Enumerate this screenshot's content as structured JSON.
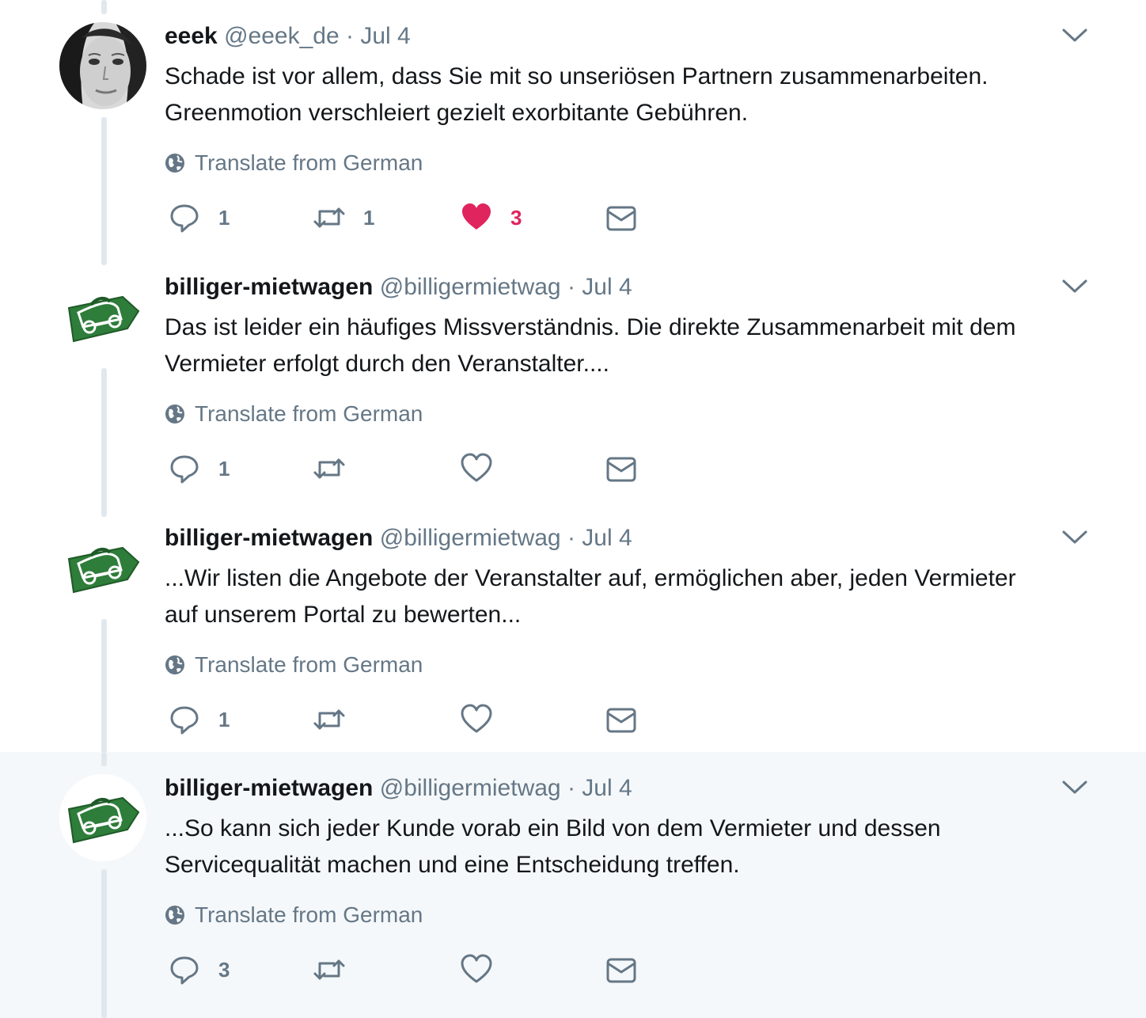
{
  "tweets": [
    {
      "name": "eeek",
      "handle": "@eeek_de",
      "separator": "·",
      "date": "Jul 4",
      "text_line1": "Schade ist vor allem, dass Sie mit so unseriösen Partnern zusammenarbeiten.",
      "text_line2": "Greenmotion verschleiert gezielt exorbitante Gebühren.",
      "translate": "Translate from German",
      "reply_count": "1",
      "retweet_count": "1",
      "like_count": "3",
      "liked": true,
      "avatar": "person-photo"
    },
    {
      "name": "billiger-mietwagen",
      "handle": "@billigermietwag",
      "separator": "·",
      "date": "Jul 4",
      "text_line1": "Das ist leider ein häufiges Missverständnis. Die direkte Zusammenarbeit mit dem",
      "text_line2": "Vermieter erfolgt durch den Veranstalter....",
      "translate": "Translate from German",
      "reply_count": "1",
      "retweet_count": "",
      "like_count": "",
      "liked": false,
      "avatar": "green-car-tag-logo"
    },
    {
      "name": "billiger-mietwagen",
      "handle": "@billigermietwag",
      "separator": "·",
      "date": "Jul 4",
      "text_line1": "...Wir listen die Angebote der Veranstalter auf, ermöglichen aber, jeden Vermieter",
      "text_line2": "auf unserem Portal zu bewerten...",
      "translate": "Translate from German",
      "reply_count": "1",
      "retweet_count": "",
      "like_count": "",
      "liked": false,
      "avatar": "green-car-tag-logo"
    },
    {
      "name": "billiger-mietwagen",
      "handle": "@billigermietwag",
      "separator": "·",
      "date": "Jul 4",
      "text_line1": "...So kann sich jeder Kunde vorab ein Bild von dem Vermieter und dessen",
      "text_line2": "Servicequalität machen und eine Entscheidung treffen.",
      "translate": "Translate from German",
      "reply_count": "3",
      "retweet_count": "",
      "like_count": "",
      "liked": false,
      "avatar": "green-car-tag-logo",
      "highlighted": true
    }
  ],
  "colors": {
    "text": "#14171a",
    "muted": "#657786",
    "like": "#e0245e",
    "thread_line": "#e1e8ed",
    "highlight_bg": "#f5f8fa",
    "logo_green": "#2e7d3a"
  }
}
